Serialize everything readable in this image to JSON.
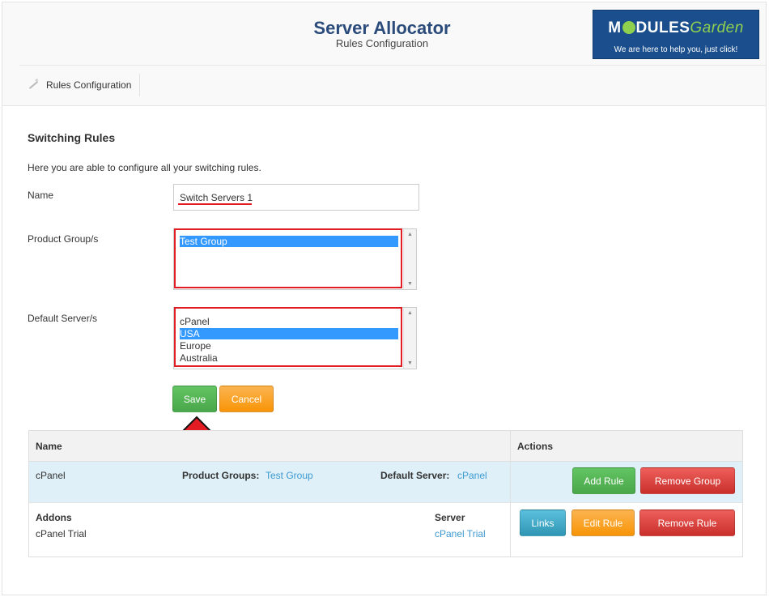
{
  "header": {
    "title": "Server Allocator",
    "subtitle": "Rules Configuration"
  },
  "logo": {
    "brand_a": "M",
    "brand_b": "DULES",
    "brand_c": "Garden",
    "tagline": "We are here to help you, just click!"
  },
  "nav": {
    "item_label": "Rules Configuration",
    "item_icon": "magic-wand-icon"
  },
  "form": {
    "section_title": "Switching Rules",
    "intro": "Here you are able to configure all your switching rules.",
    "name_label": "Name",
    "name_value": "Switch Servers 1",
    "product_group_label": "Product Group/s",
    "product_groups": [
      "Test Group"
    ],
    "default_server_label": "Default Server/s",
    "servers": [
      "cPanel",
      "USA",
      "Europe",
      "Australia"
    ],
    "selected_server": "USA",
    "save_label": "Save",
    "cancel_label": "Cancel"
  },
  "table": {
    "col_name": "Name",
    "col_actions": "Actions",
    "group_row": {
      "name": "cPanel",
      "product_groups_label": "Product Groups:",
      "product_groups_value": "Test Group",
      "default_server_label": "Default Server:",
      "default_server_value": "cPanel",
      "add_rule_label": "Add Rule",
      "remove_group_label": "Remove Group"
    },
    "item_row": {
      "addons_label": "Addons",
      "addons_value": "cPanel Trial",
      "server_label": "Server",
      "server_value": "cPanel Trial",
      "links_label": "Links",
      "edit_rule_label": "Edit Rule",
      "remove_rule_label": "Remove Rule"
    }
  },
  "colors": {
    "accent_highlight": "#e31b23",
    "selection": "#3399ff",
    "title": "#2b4b7b",
    "link": "#3d9ad1"
  }
}
